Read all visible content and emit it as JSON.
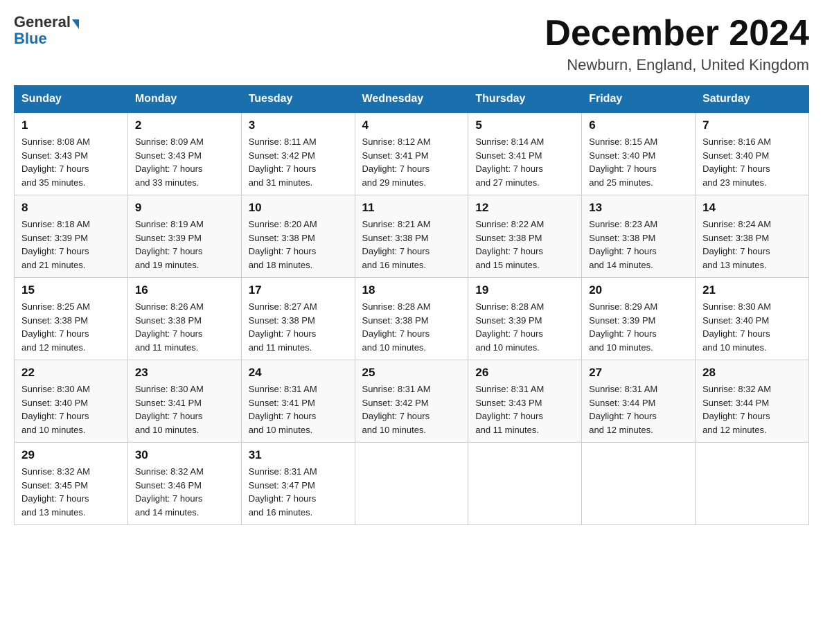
{
  "header": {
    "logo_general": "General",
    "logo_blue": "Blue",
    "month_title": "December 2024",
    "location": "Newburn, England, United Kingdom"
  },
  "days_of_week": [
    "Sunday",
    "Monday",
    "Tuesday",
    "Wednesday",
    "Thursday",
    "Friday",
    "Saturday"
  ],
  "weeks": [
    [
      {
        "day": "1",
        "sunrise": "8:08 AM",
        "sunset": "3:43 PM",
        "daylight": "7 hours and 35 minutes."
      },
      {
        "day": "2",
        "sunrise": "8:09 AM",
        "sunset": "3:43 PM",
        "daylight": "7 hours and 33 minutes."
      },
      {
        "day": "3",
        "sunrise": "8:11 AM",
        "sunset": "3:42 PM",
        "daylight": "7 hours and 31 minutes."
      },
      {
        "day": "4",
        "sunrise": "8:12 AM",
        "sunset": "3:41 PM",
        "daylight": "7 hours and 29 minutes."
      },
      {
        "day": "5",
        "sunrise": "8:14 AM",
        "sunset": "3:41 PM",
        "daylight": "7 hours and 27 minutes."
      },
      {
        "day": "6",
        "sunrise": "8:15 AM",
        "sunset": "3:40 PM",
        "daylight": "7 hours and 25 minutes."
      },
      {
        "day": "7",
        "sunrise": "8:16 AM",
        "sunset": "3:40 PM",
        "daylight": "7 hours and 23 minutes."
      }
    ],
    [
      {
        "day": "8",
        "sunrise": "8:18 AM",
        "sunset": "3:39 PM",
        "daylight": "7 hours and 21 minutes."
      },
      {
        "day": "9",
        "sunrise": "8:19 AM",
        "sunset": "3:39 PM",
        "daylight": "7 hours and 19 minutes."
      },
      {
        "day": "10",
        "sunrise": "8:20 AM",
        "sunset": "3:38 PM",
        "daylight": "7 hours and 18 minutes."
      },
      {
        "day": "11",
        "sunrise": "8:21 AM",
        "sunset": "3:38 PM",
        "daylight": "7 hours and 16 minutes."
      },
      {
        "day": "12",
        "sunrise": "8:22 AM",
        "sunset": "3:38 PM",
        "daylight": "7 hours and 15 minutes."
      },
      {
        "day": "13",
        "sunrise": "8:23 AM",
        "sunset": "3:38 PM",
        "daylight": "7 hours and 14 minutes."
      },
      {
        "day": "14",
        "sunrise": "8:24 AM",
        "sunset": "3:38 PM",
        "daylight": "7 hours and 13 minutes."
      }
    ],
    [
      {
        "day": "15",
        "sunrise": "8:25 AM",
        "sunset": "3:38 PM",
        "daylight": "7 hours and 12 minutes."
      },
      {
        "day": "16",
        "sunrise": "8:26 AM",
        "sunset": "3:38 PM",
        "daylight": "7 hours and 11 minutes."
      },
      {
        "day": "17",
        "sunrise": "8:27 AM",
        "sunset": "3:38 PM",
        "daylight": "7 hours and 11 minutes."
      },
      {
        "day": "18",
        "sunrise": "8:28 AM",
        "sunset": "3:38 PM",
        "daylight": "7 hours and 10 minutes."
      },
      {
        "day": "19",
        "sunrise": "8:28 AM",
        "sunset": "3:39 PM",
        "daylight": "7 hours and 10 minutes."
      },
      {
        "day": "20",
        "sunrise": "8:29 AM",
        "sunset": "3:39 PM",
        "daylight": "7 hours and 10 minutes."
      },
      {
        "day": "21",
        "sunrise": "8:30 AM",
        "sunset": "3:40 PM",
        "daylight": "7 hours and 10 minutes."
      }
    ],
    [
      {
        "day": "22",
        "sunrise": "8:30 AM",
        "sunset": "3:40 PM",
        "daylight": "7 hours and 10 minutes."
      },
      {
        "day": "23",
        "sunrise": "8:30 AM",
        "sunset": "3:41 PM",
        "daylight": "7 hours and 10 minutes."
      },
      {
        "day": "24",
        "sunrise": "8:31 AM",
        "sunset": "3:41 PM",
        "daylight": "7 hours and 10 minutes."
      },
      {
        "day": "25",
        "sunrise": "8:31 AM",
        "sunset": "3:42 PM",
        "daylight": "7 hours and 10 minutes."
      },
      {
        "day": "26",
        "sunrise": "8:31 AM",
        "sunset": "3:43 PM",
        "daylight": "7 hours and 11 minutes."
      },
      {
        "day": "27",
        "sunrise": "8:31 AM",
        "sunset": "3:44 PM",
        "daylight": "7 hours and 12 minutes."
      },
      {
        "day": "28",
        "sunrise": "8:32 AM",
        "sunset": "3:44 PM",
        "daylight": "7 hours and 12 minutes."
      }
    ],
    [
      {
        "day": "29",
        "sunrise": "8:32 AM",
        "sunset": "3:45 PM",
        "daylight": "7 hours and 13 minutes."
      },
      {
        "day": "30",
        "sunrise": "8:32 AM",
        "sunset": "3:46 PM",
        "daylight": "7 hours and 14 minutes."
      },
      {
        "day": "31",
        "sunrise": "8:31 AM",
        "sunset": "3:47 PM",
        "daylight": "7 hours and 16 minutes."
      },
      null,
      null,
      null,
      null
    ]
  ],
  "labels": {
    "sunrise": "Sunrise:",
    "sunset": "Sunset:",
    "daylight": "Daylight:"
  }
}
